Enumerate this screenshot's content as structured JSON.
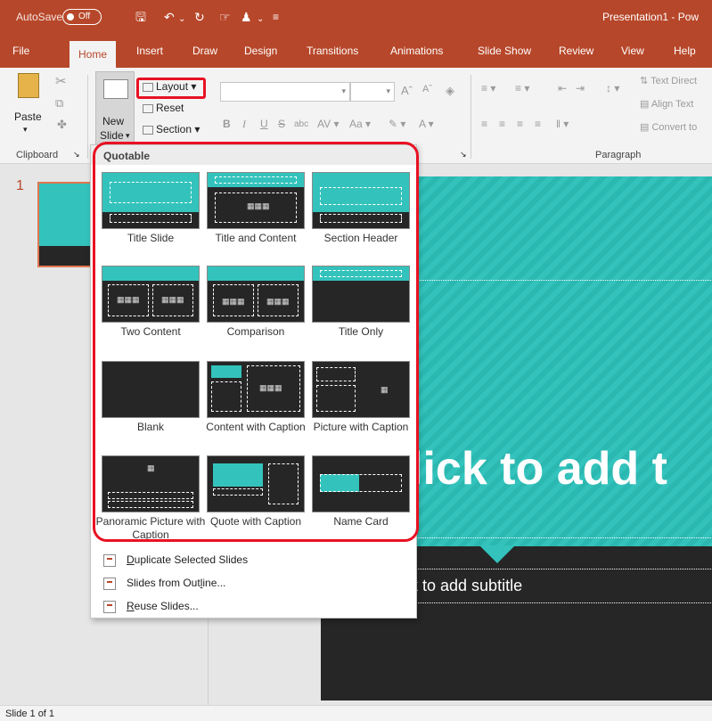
{
  "titlebar": {
    "autosave_label": "AutoSave",
    "autosave_state": "Off",
    "doc_title": "Presentation1  -  Pow",
    "bg_color": "#b7472a"
  },
  "tabs": [
    {
      "label": "File"
    },
    {
      "label": "Home"
    },
    {
      "label": "Insert"
    },
    {
      "label": "Draw"
    },
    {
      "label": "Design"
    },
    {
      "label": "Transitions"
    },
    {
      "label": "Animations"
    },
    {
      "label": "Slide Show"
    },
    {
      "label": "Review"
    },
    {
      "label": "View"
    },
    {
      "label": "Help"
    }
  ],
  "ribbon": {
    "paste_label": "Paste",
    "new_slide_label": "New",
    "new_slide_label2": "Slide",
    "layout_label": "Layout",
    "reset_label": "Reset",
    "section_label": "Section",
    "clipboard_group": "Clipboard",
    "paragraph_group": "Paragraph",
    "text_direction": "Text Direct",
    "align_text": "Align Text",
    "convert_to": "Convert to",
    "font_case": "Aa"
  },
  "dropdown": {
    "header": "Quotable",
    "layouts": [
      {
        "label": "Title Slide"
      },
      {
        "label": "Title and Content"
      },
      {
        "label": "Section Header"
      },
      {
        "label": "Two Content"
      },
      {
        "label": "Comparison"
      },
      {
        "label": "Title Only"
      },
      {
        "label": "Blank"
      },
      {
        "label": "Content with Caption"
      },
      {
        "label": "Picture with Caption"
      },
      {
        "label": "Panoramic Picture with Caption"
      },
      {
        "label": "Quote with Caption"
      },
      {
        "label": "Name Card"
      }
    ],
    "menu": [
      {
        "accel": "D",
        "rest": "uplicate Selected Slides"
      },
      {
        "pre": "Slides from Out",
        "accel": "l",
        "rest": "ine..."
      },
      {
        "accel": "R",
        "rest": "euse Slides..."
      }
    ]
  },
  "slide_pane": {
    "slide_number": "1"
  },
  "slide": {
    "title_placeholder": "lick to add t",
    "subtitle_placeholder": "k to add subtitle",
    "teal_color": "#33c3bc",
    "dark_color": "#262626"
  },
  "status": {
    "text": "Slide 1 of 1"
  }
}
